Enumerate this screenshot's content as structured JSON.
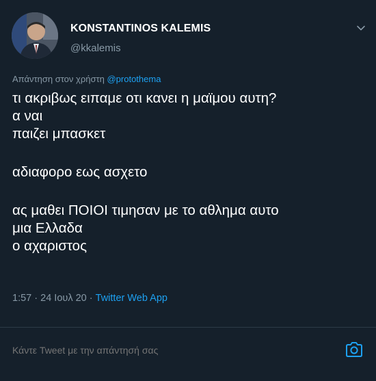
{
  "colors": {
    "background": "#15202b",
    "text_primary": "#ffffff",
    "text_secondary": "#8899a6",
    "accent": "#1da1f2",
    "divider": "#2c3a47"
  },
  "author": {
    "display_name": "KONSTANTINOS KALEMIS",
    "handle": "@kkalemis",
    "avatar": "avatar-photo"
  },
  "reply_context": {
    "prefix": "Απάντηση στον χρήστη",
    "mention": "@protothema"
  },
  "tweet": {
    "lines": [
      "τι ακριβως ειπαμε οτι κανει η μαϊμου αυτη?",
      "α ναι",
      "παιζει μπασκετ",
      "",
      "αδιαφορο εως ασχετο",
      "",
      "ας μαθει ΠΟΙΟΙ τιμησαν με το αθλημα αυτο",
      "μια Ελλαδα",
      "ο αχαριστος"
    ],
    "time": "1:57",
    "separator": "·",
    "date": "24 Ιουλ 20",
    "source": "Twitter Web App"
  },
  "icons": {
    "menu": "chevron-down-icon",
    "camera": "camera-icon"
  },
  "reply_bar": {
    "placeholder": "Κάντε Tweet με την απάντησή σας"
  }
}
